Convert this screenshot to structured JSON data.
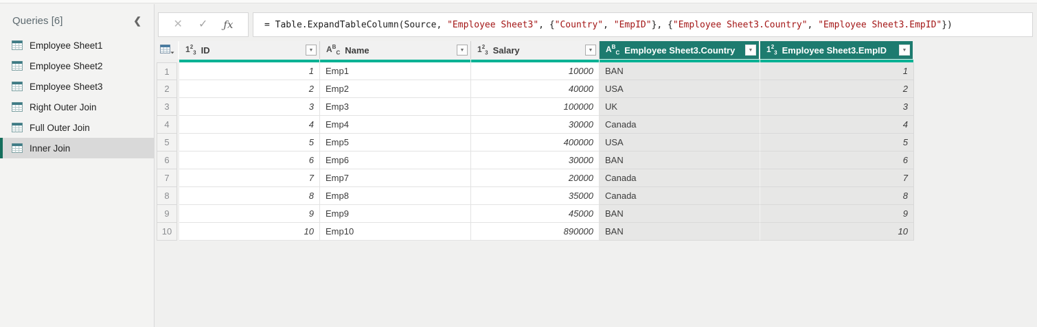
{
  "sidebar": {
    "title": "Queries [6]",
    "collapse_icon": "chevron-left",
    "items": [
      {
        "label": "Employee Sheet1",
        "selected": false
      },
      {
        "label": "Employee Sheet2",
        "selected": false
      },
      {
        "label": "Employee Sheet3",
        "selected": false
      },
      {
        "label": "Right Outer Join",
        "selected": false
      },
      {
        "label": "Full Outer Join",
        "selected": false
      },
      {
        "label": "Inner Join",
        "selected": true
      }
    ]
  },
  "formula_bar": {
    "cancel_label": "✕",
    "confirm_label": "✓",
    "fx_label": "ƒx",
    "formula_segments": [
      {
        "text": "= Table.ExpandTableColumn(Source, ",
        "kind": "code"
      },
      {
        "text": "\"Employee Sheet3\"",
        "kind": "string"
      },
      {
        "text": ", {",
        "kind": "code"
      },
      {
        "text": "\"Country\"",
        "kind": "string"
      },
      {
        "text": ", ",
        "kind": "code"
      },
      {
        "text": "\"EmpID\"",
        "kind": "string"
      },
      {
        "text": "}, {",
        "kind": "code"
      },
      {
        "text": "\"Employee Sheet3.Country\"",
        "kind": "string"
      },
      {
        "text": ", ",
        "kind": "code"
      },
      {
        "text": "\"Employee Sheet3.EmpID\"",
        "kind": "string"
      },
      {
        "text": "})",
        "kind": "code"
      }
    ]
  },
  "table": {
    "columns": [
      {
        "name": "ID",
        "type_icon": "123",
        "align": "right",
        "selected": false
      },
      {
        "name": "Name",
        "type_icon": "ABC",
        "align": "left",
        "selected": false
      },
      {
        "name": "Salary",
        "type_icon": "123",
        "align": "right",
        "selected": false
      },
      {
        "name": "Employee Sheet3.Country",
        "type_icon": "ABC",
        "align": "left",
        "selected": true
      },
      {
        "name": "Employee Sheet3.EmpID",
        "type_icon": "123",
        "align": "right",
        "selected": true
      }
    ],
    "rows": [
      [
        "1",
        "Emp1",
        "10000",
        "BAN",
        "1"
      ],
      [
        "2",
        "Emp2",
        "40000",
        "USA",
        "2"
      ],
      [
        "3",
        "Emp3",
        "100000",
        "UK",
        "3"
      ],
      [
        "4",
        "Emp4",
        "30000",
        "Canada",
        "4"
      ],
      [
        "5",
        "Emp5",
        "400000",
        "USA",
        "5"
      ],
      [
        "6",
        "Emp6",
        "30000",
        "BAN",
        "6"
      ],
      [
        "7",
        "Emp7",
        "20000",
        "Canada",
        "7"
      ],
      [
        "8",
        "Emp8",
        "35000",
        "Canada",
        "8"
      ],
      [
        "9",
        "Emp9",
        "45000",
        "BAN",
        "9"
      ],
      [
        "10",
        "Emp10",
        "890000",
        "BAN",
        "10"
      ]
    ]
  },
  "colors": {
    "selected_header": "#1d7b6f",
    "quality_bar": "#00b294",
    "selection_stripe": "#156e5c",
    "string_literal": "#a31515"
  }
}
